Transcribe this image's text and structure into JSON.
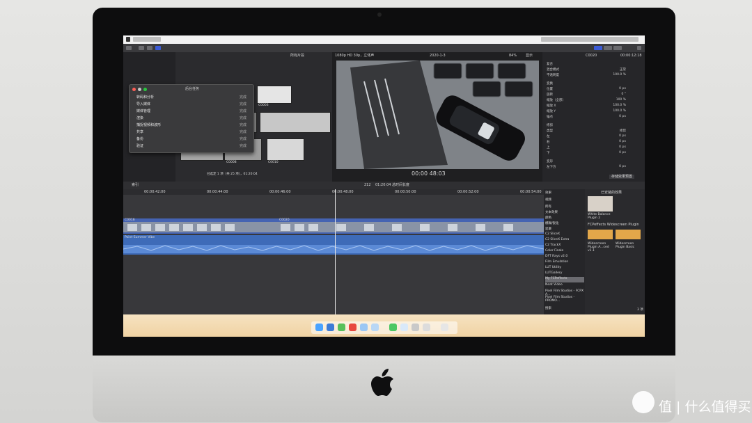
{
  "browser": {
    "filter_label": "所有片段",
    "library_item": "r32",
    "status_text": "已选定 1 项（共 25 项），01:20:04",
    "thumbnails": [
      "C0003",
      "C0005",
      "C0006",
      "C0008",
      "C0009",
      "C0010"
    ]
  },
  "popup": {
    "title": "后台任务",
    "rows": [
      {
        "label": "转码和分析",
        "status": "完成"
      },
      {
        "label": "导入媒体",
        "status": "完成"
      },
      {
        "label": "媒体管理",
        "status": "完成"
      },
      {
        "label": "渲染",
        "status": "完成"
      },
      {
        "label": "捕捉视频和波形",
        "status": "完成"
      },
      {
        "label": "共享",
        "status": "完成"
      },
      {
        "label": "备份",
        "status": "完成"
      },
      {
        "label": "验证",
        "status": "完成"
      }
    ]
  },
  "viewer": {
    "format": "1080p HD 30p，立体声",
    "project": "2020-1-3",
    "zoom": "84%",
    "display_menu": "显示",
    "timecode": "00:00 48:03"
  },
  "inspector": {
    "clip_name": "C0020",
    "duration": "00:00:12:18",
    "rows": [
      {
        "label": "复合",
        "value": ""
      },
      {
        "label": "混合模式",
        "value": "正常"
      },
      {
        "label": "不透明度",
        "value": "100.0 %"
      },
      {
        "label": "变换",
        "value": ""
      },
      {
        "label": "位置",
        "value": "0 px"
      },
      {
        "label": "旋转",
        "value": "0 °"
      },
      {
        "label": "缩放（全部）",
        "value": "100 %"
      },
      {
        "label": "缩放 X",
        "value": "100.0 %"
      },
      {
        "label": "缩放 Y",
        "value": "100.0 %"
      },
      {
        "label": "锚点",
        "value": "0 px"
      },
      {
        "label": "修剪",
        "value": ""
      },
      {
        "label": "类型",
        "value": "修剪"
      },
      {
        "label": "左",
        "value": "0 px"
      },
      {
        "label": "右",
        "value": "0 px"
      },
      {
        "label": "上",
        "value": "0 px"
      },
      {
        "label": "下",
        "value": "0 px"
      },
      {
        "label": "变形",
        "value": ""
      },
      {
        "label": "左下方",
        "value": "0 px"
      }
    ],
    "save_button": "存储效果预置"
  },
  "timeline": {
    "index_label": "索引",
    "center_info": "212",
    "duration_info": "01:20:04 总时间长度",
    "ruler": [
      "00:00:42:00",
      "00:00:44:00",
      "00:00:46:00",
      "00:00:48:00",
      "00:00:50:00",
      "00:00:52:00",
      "00:00:54:00"
    ],
    "clip_labels": [
      "C0016",
      "C0020"
    ],
    "audio_label": "Point-Summer Vibe"
  },
  "effects": {
    "header": "效果",
    "installed_header": "已安装的效果",
    "list": [
      "视频",
      "所有",
      "文本效果",
      "颜色",
      "模糊/锐化",
      "遮罩",
      "C2 SliceX",
      "C2 SliceX Extra",
      "C2 TrackX",
      "Color Finale",
      "DFT Rays v2.0",
      "Film Emulation",
      "LUT Utility",
      "LUTGallery",
      "My FCPeffects",
      "Neat Video",
      "Pixel Film Studios - FCPX A...",
      "Pixel Film Studios - PROMO..."
    ],
    "tile1": "White Balance Plugin 2",
    "group": "FCPeffects Widescreen Plugin",
    "tile2": "Widescreen Plugin A...ced v1.1",
    "tile3": "Widescreen Plugin Basic",
    "count": "3 项",
    "search_placeholder": "搜索"
  },
  "watermark": "值 | 什么值得买"
}
